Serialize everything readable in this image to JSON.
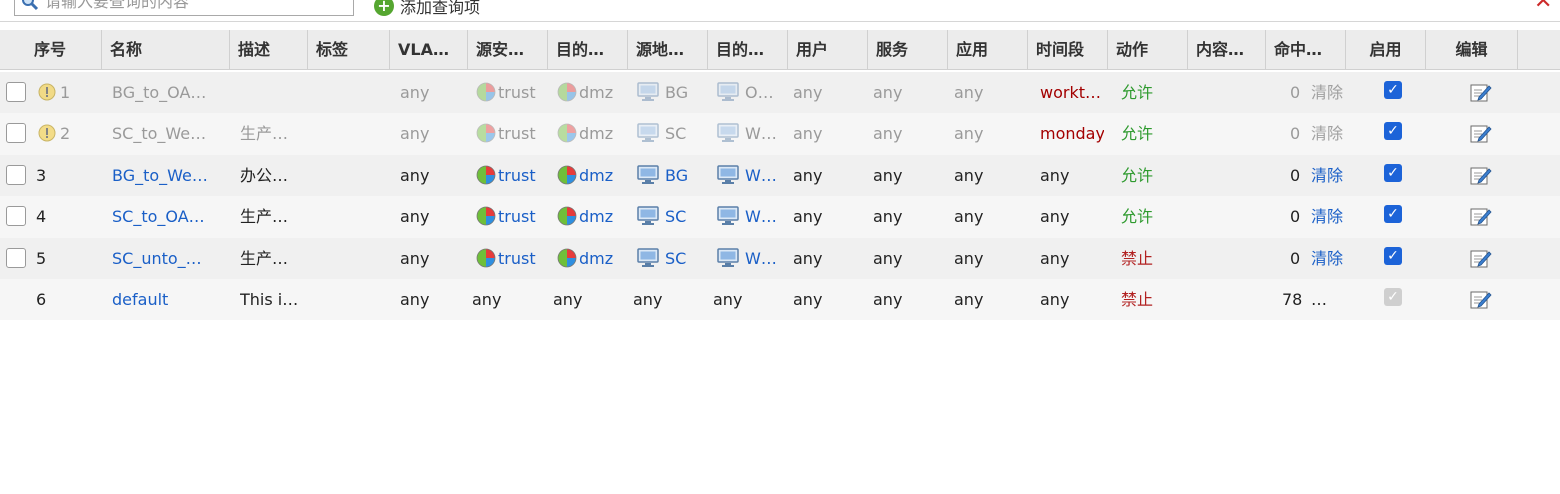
{
  "toolbar": {
    "search_placeholder": "请输入要查询的内容",
    "add_query_label": "添加查询项",
    "close_label": "✕"
  },
  "columns": [
    "序号",
    "名称",
    "描述",
    "标签",
    "VLA…",
    "源安…",
    "目的…",
    "源地…",
    "目的…",
    "用户",
    "服务",
    "应用",
    "时间段",
    "动作",
    "内容…",
    "命中…",
    "启用",
    "编辑"
  ],
  "rows": [
    {
      "id": "1",
      "name": "BG_to_OA…",
      "desc": "",
      "vlan": "any",
      "src_zone": "trust",
      "dst_zone": "dmz",
      "src_addr": "BG",
      "dst_addr": "O…",
      "user": "any",
      "service": "any",
      "app": "any",
      "time": "workt…",
      "action": "允许",
      "hits": "0",
      "clear": "清除",
      "enabled": true,
      "state": "disabled"
    },
    {
      "id": "2",
      "name": "SC_to_We…",
      "desc": "生产…",
      "vlan": "any",
      "src_zone": "trust",
      "dst_zone": "dmz",
      "src_addr": "SC",
      "dst_addr": "W…",
      "user": "any",
      "service": "any",
      "app": "any",
      "time": "monday",
      "action": "允许",
      "hits": "0",
      "clear": "清除",
      "enabled": true,
      "state": "disabled"
    },
    {
      "id": "3",
      "name": "BG_to_We…",
      "desc": "办公…",
      "vlan": "any",
      "src_zone": "trust",
      "dst_zone": "dmz",
      "src_addr": "BG",
      "dst_addr": "W…",
      "user": "any",
      "service": "any",
      "app": "any",
      "time": "any",
      "action": "允许",
      "hits": "0",
      "clear": "清除",
      "enabled": true,
      "state": "active"
    },
    {
      "id": "4",
      "name": "SC_to_OA…",
      "desc": "生产…",
      "vlan": "any",
      "src_zone": "trust",
      "dst_zone": "dmz",
      "src_addr": "SC",
      "dst_addr": "W…",
      "user": "any",
      "service": "any",
      "app": "any",
      "time": "any",
      "action": "允许",
      "hits": "0",
      "clear": "清除",
      "enabled": true,
      "state": "active"
    },
    {
      "id": "5",
      "name": "SC_unto_…",
      "desc": "生产…",
      "vlan": "any",
      "src_zone": "trust",
      "dst_zone": "dmz",
      "src_addr": "SC",
      "dst_addr": "W…",
      "user": "any",
      "service": "any",
      "app": "any",
      "time": "any",
      "action": "禁止",
      "hits": "0",
      "clear": "清除",
      "enabled": true,
      "state": "active"
    },
    {
      "id": "6",
      "name": "default",
      "desc": "This i…",
      "vlan": "any",
      "src_zone": "any",
      "dst_zone": "any",
      "src_addr": "any",
      "dst_addr": "any",
      "user": "any",
      "service": "any",
      "app": "any",
      "time": "any",
      "action": "禁止",
      "hits": "78",
      "clear": "…",
      "enabled": true,
      "state": "default"
    }
  ],
  "colors": {
    "link": "#1a5fc7",
    "allow": "#2e9a2e",
    "deny": "#b22222",
    "time": "#a30000",
    "header_bg": "#ececec"
  }
}
